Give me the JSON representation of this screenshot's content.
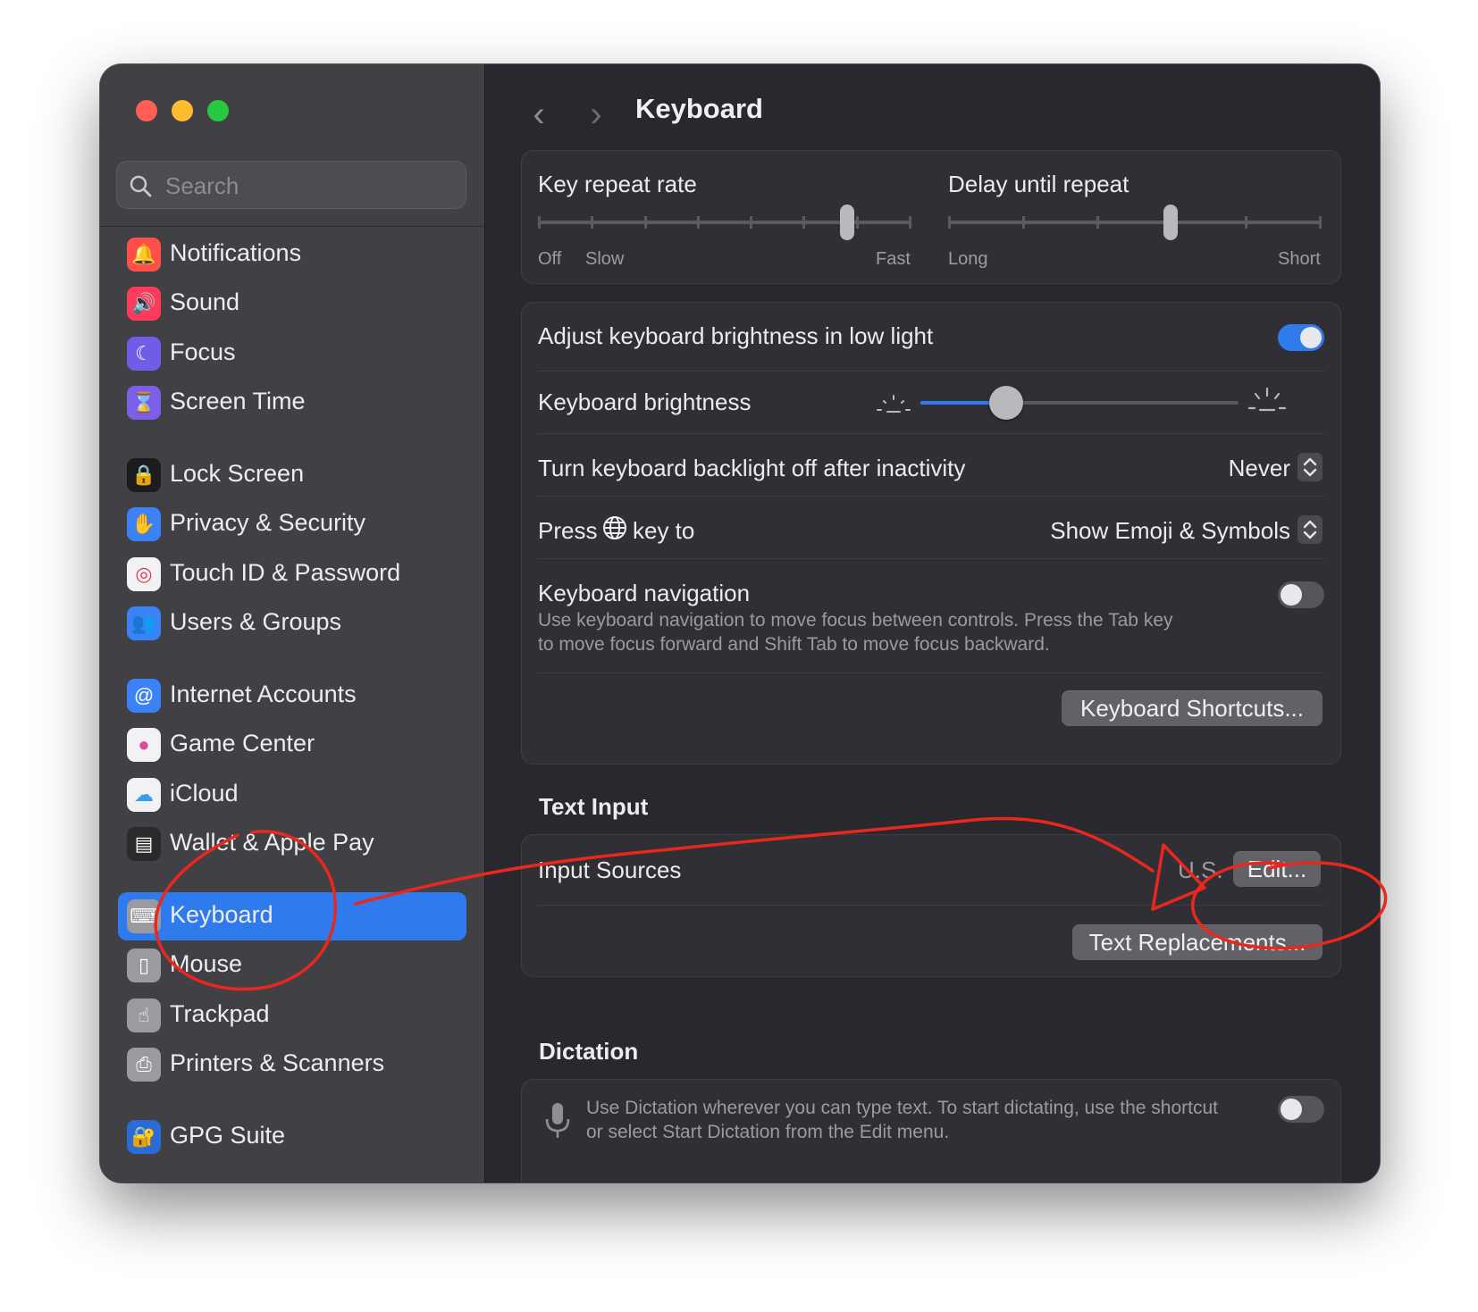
{
  "window": {
    "title": "Keyboard"
  },
  "search": {
    "placeholder": "Search"
  },
  "sidebar": {
    "items": [
      {
        "label": "Notifications",
        "icon": "bell-icon",
        "color": "#ff4f4a"
      },
      {
        "label": "Sound",
        "icon": "speaker-icon",
        "color": "#ff3b5c"
      },
      {
        "label": "Focus",
        "icon": "moon-icon",
        "color": "#6f5de8"
      },
      {
        "label": "Screen Time",
        "icon": "hourglass-icon",
        "color": "#7c5fe8"
      },
      {
        "label": "Lock Screen",
        "icon": "lock-icon",
        "color": "#1c1c1e"
      },
      {
        "label": "Privacy & Security",
        "icon": "hand-icon",
        "color": "#3b82f6"
      },
      {
        "label": "Touch ID & Password",
        "icon": "fingerprint-icon",
        "color": "#f2f2f5"
      },
      {
        "label": "Users & Groups",
        "icon": "users-icon",
        "color": "#3b82f6"
      },
      {
        "label": "Internet Accounts",
        "icon": "at-sign-icon",
        "color": "#3b82f6"
      },
      {
        "label": "Game Center",
        "icon": "game-center-icon",
        "color": "#f2f2f5"
      },
      {
        "label": "iCloud",
        "icon": "cloud-icon",
        "color": "#f2f2f5"
      },
      {
        "label": "Wallet & Apple Pay",
        "icon": "wallet-icon",
        "color": "#2a2a2c"
      },
      {
        "label": "Keyboard",
        "icon": "keyboard-icon",
        "color": "#9a9aa0"
      },
      {
        "label": "Mouse",
        "icon": "mouse-icon",
        "color": "#9a9aa0"
      },
      {
        "label": "Trackpad",
        "icon": "trackpad-icon",
        "color": "#9a9aa0"
      },
      {
        "label": "Printers & Scanners",
        "icon": "printer-icon",
        "color": "#9a9aa0"
      },
      {
        "label": "GPG Suite",
        "icon": "gpg-lock-icon",
        "color": "#2a6bd6"
      }
    ],
    "active_index": 12
  },
  "key_repeat": {
    "repeat_rate_label": "Key repeat rate",
    "repeat_rate_off": "Off",
    "repeat_rate_slow": "Slow",
    "repeat_rate_fast": "Fast",
    "repeat_rate_level": 0.84,
    "delay_label": "Delay until repeat",
    "delay_long": "Long",
    "delay_short": "Short",
    "delay_level": 0.6
  },
  "brightness": {
    "adjust_label": "Adjust keyboard brightness in low light",
    "adjust_on": true,
    "brightness_label": "Keyboard brightness",
    "brightness_level": 0.27,
    "backlight_label": "Turn keyboard backlight off after inactivity",
    "backlight_value": "Never",
    "press_label_before": "Press",
    "press_label_after": "key to",
    "press_value": "Show Emoji & Symbols",
    "nav_label": "Keyboard navigation",
    "nav_desc_line1": "Use keyboard navigation to move focus between controls. Press the Tab key",
    "nav_desc_line2": "to move focus forward and Shift Tab to move focus backward.",
    "nav_on": false,
    "shortcuts_button": "Keyboard Shortcuts..."
  },
  "text_input": {
    "section_title": "Text Input",
    "input_sources_label": "Input Sources",
    "input_sources_value": "U.S.",
    "edit_button": "Edit...",
    "text_replacements_button": "Text Replacements..."
  },
  "dictation": {
    "section_title": "Dictation",
    "desc_line1": "Use Dictation wherever you can type text. To start dictating, use the shortcut",
    "desc_line2": "or select Start Dictation from the Edit menu.",
    "on": false
  },
  "colors": {
    "accent": "#2f7bed",
    "annotation": "#e8281e"
  }
}
